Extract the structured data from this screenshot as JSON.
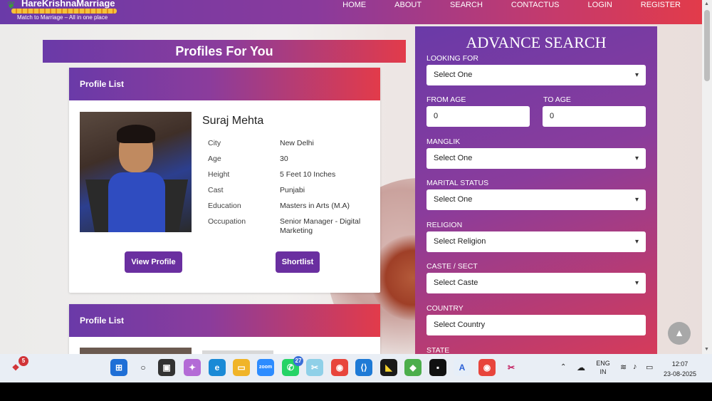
{
  "nav": {
    "brand": "HareKrishnaMarriage",
    "tagline": "Match to Marriage – All in one place",
    "links": [
      "HOME",
      "ABOUT",
      "SEARCH",
      "CONTACTUS",
      "LOGIN",
      "REGISTER"
    ]
  },
  "main": {
    "section_title": "Profiles For You",
    "cards": [
      {
        "header": "Profile List",
        "name": "Suraj Mehta",
        "details": [
          {
            "key": "City",
            "value": "New Delhi"
          },
          {
            "key": "Age",
            "value": "30"
          },
          {
            "key": "Height",
            "value": "5 Feet 10 Inches"
          },
          {
            "key": "Cast",
            "value": "Punjabi"
          },
          {
            "key": "Education",
            "value": "Masters in Arts (M.A)"
          },
          {
            "key": "Occupation",
            "value": "Senior Manager - Digital Marketing"
          }
        ],
        "view_label": "View Profile",
        "shortlist_label": "Shortlist"
      },
      {
        "header": "Profile List"
      }
    ]
  },
  "search": {
    "title": "ADVANCE SEARCH",
    "looking_for_label": "LOOKING FOR",
    "looking_for_value": "Select One",
    "from_age_label": "FROM AGE",
    "from_age_value": "0",
    "to_age_label": "TO AGE",
    "to_age_value": "0",
    "manglik_label": "MANGLIK",
    "manglik_value": "Select One",
    "marital_label": "MARITAL STATUS",
    "marital_value": "Select One",
    "religion_label": "RELIGION",
    "religion_value": "Select Religion",
    "caste_label": "CASTE / SECT",
    "caste_value": "Select Caste",
    "country_label": "COUNTRY",
    "country_value": "Select Country",
    "state_label": "STATE"
  },
  "taskbar": {
    "notif_badge": "5",
    "whatsapp_badge": "27",
    "lang_top": "ENG",
    "lang_bottom": "IN",
    "time": "12:07",
    "date": "23-08-2025"
  },
  "icons": {
    "chevron": "chevron-down-icon",
    "scroll_top": "arrow-up-icon"
  }
}
